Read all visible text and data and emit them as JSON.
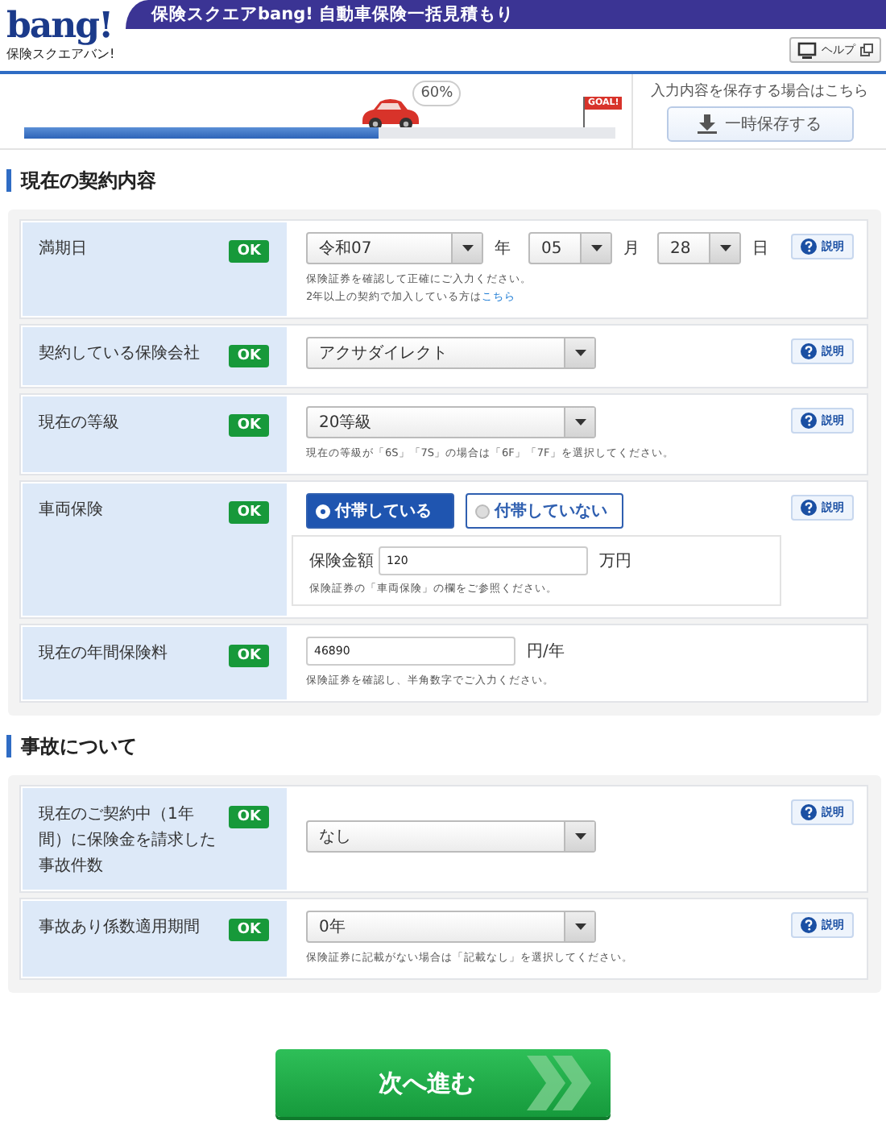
{
  "header": {
    "logo": {
      "wordmark": "bang!",
      "caption": "保険スクエアバン!"
    },
    "title": "保険スクエアbang! 自動車保険一括見積もり",
    "help_button": "ヘルプ"
  },
  "progress": {
    "level": 0.6,
    "percent": "60%",
    "goal_label": "GOAL!"
  },
  "save": {
    "note": "入力内容を保存する場合はこちら",
    "button": "一時保存する"
  },
  "sections": [
    {
      "title": "現在の契約内容",
      "rows": [
        {
          "kind": "date",
          "label": "満期日",
          "status": "OK",
          "help_button": "説明",
          "parts": [
            {
              "value": "令和07",
              "unit": "年"
            },
            {
              "value": "05",
              "unit": "月"
            },
            {
              "value": "28",
              "unit": "日"
            }
          ],
          "notes": [
            {
              "text": "保険証券を確認して正確にご入力ください。"
            },
            {
              "text": "2年以上の契約で加入している方は",
              "link": "こちら"
            }
          ]
        },
        {
          "kind": "select",
          "label": "契約している保険会社",
          "status": "OK",
          "help_button": "説明",
          "value": "アクサダイレクト"
        },
        {
          "kind": "select",
          "label": "現在の等級",
          "status": "OK",
          "help_button": "説明",
          "value": "20等級",
          "notes": [
            {
              "text": "現在の等級が「6S」「7S」の場合は「6F」「7F」を選択してください。"
            }
          ]
        },
        {
          "kind": "radio",
          "label": "車両保険",
          "status": "OK",
          "help_button": "説明",
          "options": [
            {
              "label": "付帯している",
              "selected": true
            },
            {
              "label": "付帯していない",
              "selected": false
            }
          ],
          "subfield": {
            "label": "保険金額",
            "value": "120",
            "unit": "万円",
            "note": "保険証券の「車両保険」の欄をご参照ください。"
          }
        },
        {
          "kind": "text",
          "label": "現在の年間保険料",
          "status": "OK",
          "value": "46890",
          "unit": "円/年",
          "notes": [
            {
              "text": "保険証券を確認し、半角数字でご入力ください。"
            }
          ]
        }
      ]
    },
    {
      "title": "事故について",
      "rows": [
        {
          "kind": "select",
          "label": "現在のご契約中（1年間）に保険金を請求した事故件数",
          "status": "OK",
          "help_button": "説明",
          "value": "なし"
        },
        {
          "kind": "select",
          "label": "事故あり係数適用期間",
          "status": "OK",
          "help_button": "説明",
          "value": "0年",
          "notes": [
            {
              "text": "保険証券に記載がない場合は「記載なし」を選択してください。"
            }
          ]
        }
      ]
    }
  ],
  "next_button": "次へ進む"
}
